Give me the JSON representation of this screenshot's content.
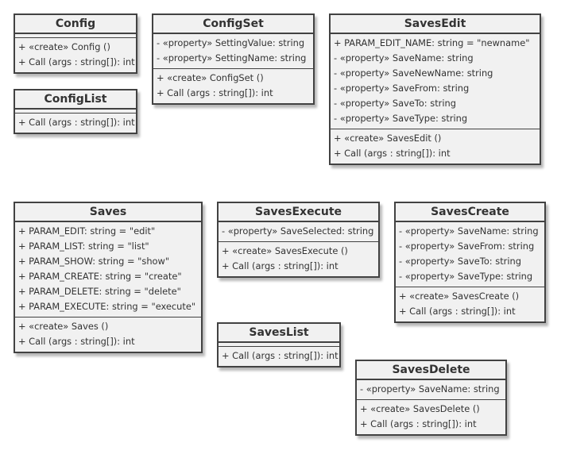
{
  "classes": {
    "config": {
      "name": "Config",
      "members": [],
      "methods": [
        "+ «create» Config ()",
        "+ Call (args : string[]): int"
      ]
    },
    "config_list": {
      "name": "ConfigList",
      "members": [],
      "methods": [
        "+ Call (args : string[]): int"
      ]
    },
    "config_set": {
      "name": "ConfigSet",
      "members": [
        "- «property» SettingValue: string",
        "- «property» SettingName: string"
      ],
      "methods": [
        "+ «create» ConfigSet ()",
        "+ Call (args : string[]): int"
      ]
    },
    "saves_edit": {
      "name": "SavesEdit",
      "members": [
        "+ PARAM_EDIT_NAME: string = \"newname\"",
        "- «property» SaveName: string",
        "- «property» SaveNewName: string",
        "- «property» SaveFrom: string",
        "- «property» SaveTo: string",
        "- «property» SaveType: string"
      ],
      "methods": [
        "+ «create» SavesEdit ()",
        "+ Call (args : string[]): int"
      ]
    },
    "saves": {
      "name": "Saves",
      "members": [
        "+ PARAM_EDIT: string = \"edit\"",
        "+ PARAM_LIST: string = \"list\"",
        "+ PARAM_SHOW: string = \"show\"",
        "+ PARAM_CREATE: string = \"create\"",
        "+ PARAM_DELETE: string = \"delete\"",
        "+ PARAM_EXECUTE: string = \"execute\""
      ],
      "methods": [
        "+ «create» Saves ()",
        "+ Call (args : string[]): int"
      ]
    },
    "saves_execute": {
      "name": "SavesExecute",
      "members": [
        "- «property» SaveSelected: string"
      ],
      "methods": [
        "+ «create» SavesExecute ()",
        "+ Call (args : string[]): int"
      ]
    },
    "saves_create": {
      "name": "SavesCreate",
      "members": [
        "- «property» SaveName: string",
        "- «property» SaveFrom: string",
        "- «property» SaveTo: string",
        "- «property» SaveType: string"
      ],
      "methods": [
        "+ «create» SavesCreate ()",
        "+ Call (args : string[]): int"
      ]
    },
    "saves_list": {
      "name": "SavesList",
      "members": [],
      "methods": [
        "+ Call (args : string[]): int"
      ]
    },
    "saves_delete": {
      "name": "SavesDelete",
      "members": [
        "- «property» SaveName: string"
      ],
      "methods": [
        "+ «create» SavesDelete ()",
        "+ Call (args : string[]): int"
      ]
    }
  }
}
